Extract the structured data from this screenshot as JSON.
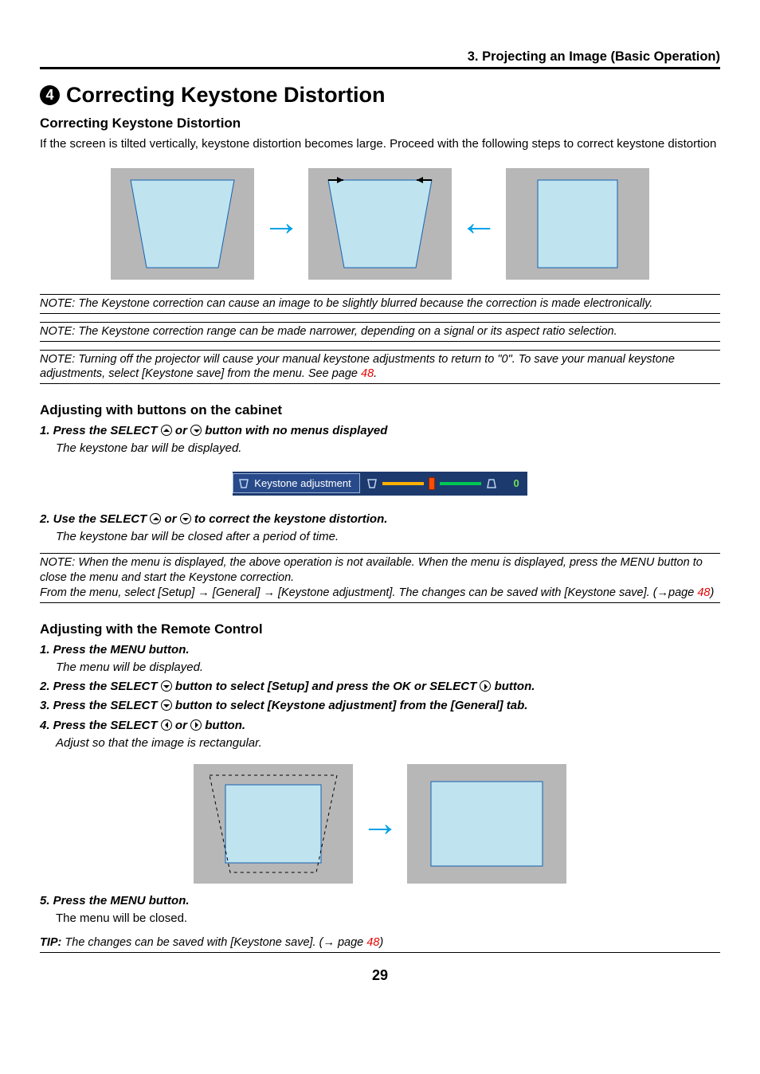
{
  "header": {
    "breadcrumb": "3. Projecting an Image (Basic Operation)"
  },
  "title": {
    "number": "4",
    "text": "Correcting Keystone Distortion"
  },
  "section1": {
    "heading": "Correcting Keystone Distortion",
    "body": "If the screen is tilted vertically, keystone distortion becomes large. Proceed with the following steps to correct keystone distortion"
  },
  "notes": {
    "n1": "NOTE: The Keystone correction can cause an image to be slightly blurred because the correction is made electronically.",
    "n2": "NOTE: The Keystone correction range can be made narrower, depending on a signal or its aspect ratio selection.",
    "n3_a": "NOTE: Turning off the projector will cause your manual keystone adjustments to return to \"0\". To save your manual keystone adjustments, select [Keystone save] from the menu. See page ",
    "n3_link": "48",
    "n3_b": "."
  },
  "cabinet": {
    "heading": "Adjusting with buttons on the cabinet",
    "step1_a": "1.  Press the SELECT ",
    "step1_b": " or ",
    "step1_c": " button with no menus displayed",
    "step1_sub": "The keystone bar will be displayed.",
    "step2_a": "2.  Use the SELECT ",
    "step2_b": " or ",
    "step2_c": " to correct the keystone distortion.",
    "step2_sub": "The keystone bar will be closed after a period of time."
  },
  "keystone_bar": {
    "label": "Keystone adjustment",
    "value": "0"
  },
  "note4": {
    "a": "NOTE: When the menu is displayed, the above operation is not available. When the menu is displayed, press the MENU button to close the menu and start the Keystone correction.",
    "b_a": "From the menu, select [Setup] → [General] → [Keystone adjustment]. The changes can be saved with [Keystone save]. (→page ",
    "b_link": "48",
    "b_b": ")"
  },
  "remote": {
    "heading": "Adjusting with the Remote Control",
    "s1": "1.  Press the MENU button.",
    "s1_sub": "The menu will be displayed.",
    "s2_a": "2.  Press the SELECT ",
    "s2_b": " button to select [Setup] and press the OK or SELECT ",
    "s2_c": " button.",
    "s3_a": "3.  Press the SELECT ",
    "s3_b": " button to select [Keystone adjustment] from the [General] tab.",
    "s4_a": "4.  Press the SELECT ",
    "s4_b": " or ",
    "s4_c": " button.",
    "s4_sub": "Adjust so that the image is rectangular.",
    "s5": "5.  Press the MENU button.",
    "s5_sub": "The menu will be closed."
  },
  "tip": {
    "a": "TIP:",
    "b": " The changes can be saved with [Keystone save]. (→ page ",
    "link": "48",
    "c": ")"
  },
  "pagenum": "29"
}
